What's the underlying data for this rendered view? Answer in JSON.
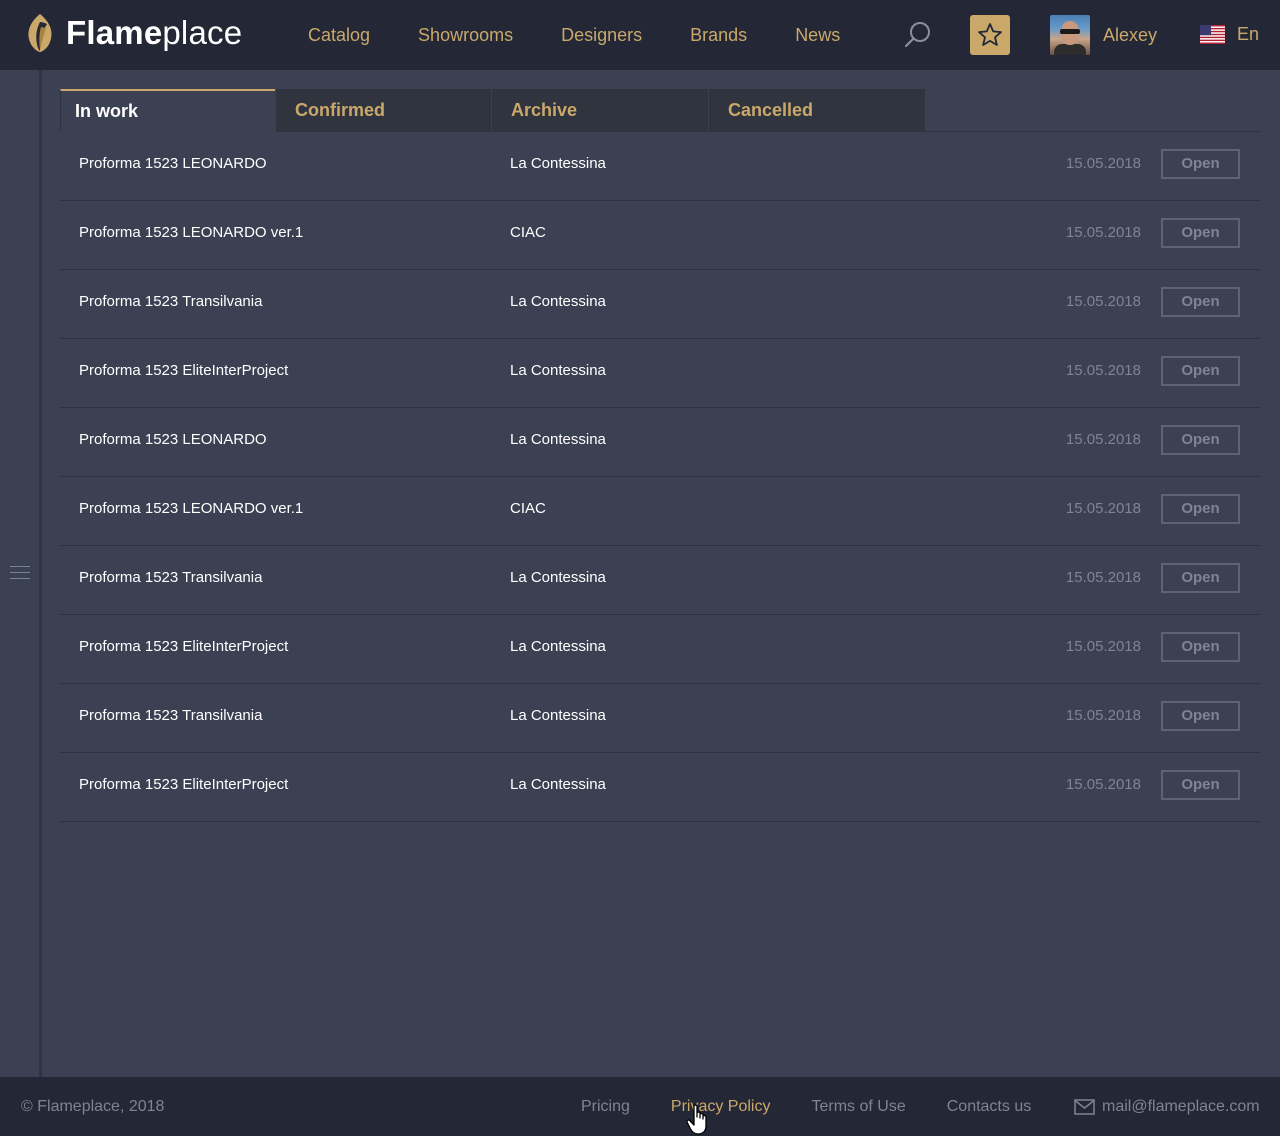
{
  "header": {
    "logo_bold": "Flame",
    "logo_light": "place",
    "nav": [
      "Catalog",
      "Showrooms",
      "Designers",
      "Brands",
      "News"
    ],
    "user_name": "Alexey",
    "language": "En"
  },
  "tabs": [
    "In work",
    "Confirmed",
    "Archive",
    "Cancelled"
  ],
  "active_tab": "In work",
  "rows": [
    {
      "name": "Proforma 1523 LEONARDO",
      "company": "La Contessina",
      "date": "15.05.2018",
      "action": "Open"
    },
    {
      "name": "Proforma 1523 LEONARDO ver.1",
      "company": "CIAC",
      "date": "15.05.2018",
      "action": "Open"
    },
    {
      "name": "Proforma 1523 Transilvania",
      "company": "La Contessina",
      "date": "15.05.2018",
      "action": "Open"
    },
    {
      "name": "Proforma 1523 EliteInterProject",
      "company": "La Contessina",
      "date": "15.05.2018",
      "action": "Open"
    },
    {
      "name": "Proforma 1523 LEONARDO",
      "company": "La Contessina",
      "date": "15.05.2018",
      "action": "Open"
    },
    {
      "name": "Proforma 1523 LEONARDO ver.1",
      "company": "CIAC",
      "date": "15.05.2018",
      "action": "Open"
    },
    {
      "name": "Proforma 1523 Transilvania",
      "company": "La Contessina",
      "date": "15.05.2018",
      "action": "Open"
    },
    {
      "name": "Proforma 1523 EliteInterProject",
      "company": "La Contessina",
      "date": "15.05.2018",
      "action": "Open"
    },
    {
      "name": "Proforma 1523 Transilvania",
      "company": "La Contessina",
      "date": "15.05.2018",
      "action": "Open"
    },
    {
      "name": "Proforma 1523 EliteInterProject",
      "company": "La Contessina",
      "date": "15.05.2018",
      "action": "Open"
    }
  ],
  "footer": {
    "copyright": "© Flameplace, 2018",
    "links": [
      "Pricing",
      "Privacy Policy",
      "Terms of Use",
      "Contacts us"
    ],
    "email": "mail@flameplace.com"
  },
  "colors": {
    "accent": "#c9a86a",
    "header_bg": "#242836",
    "page_bg": "#3b4052",
    "muted_text": "#7e8396"
  },
  "icons": {
    "logo": "flame-logo-icon",
    "search": "search-icon",
    "favorites": "star-icon",
    "language": "us-flag-icon",
    "sidebar": "hamburger-menu-icon",
    "mail": "envelope-icon"
  }
}
